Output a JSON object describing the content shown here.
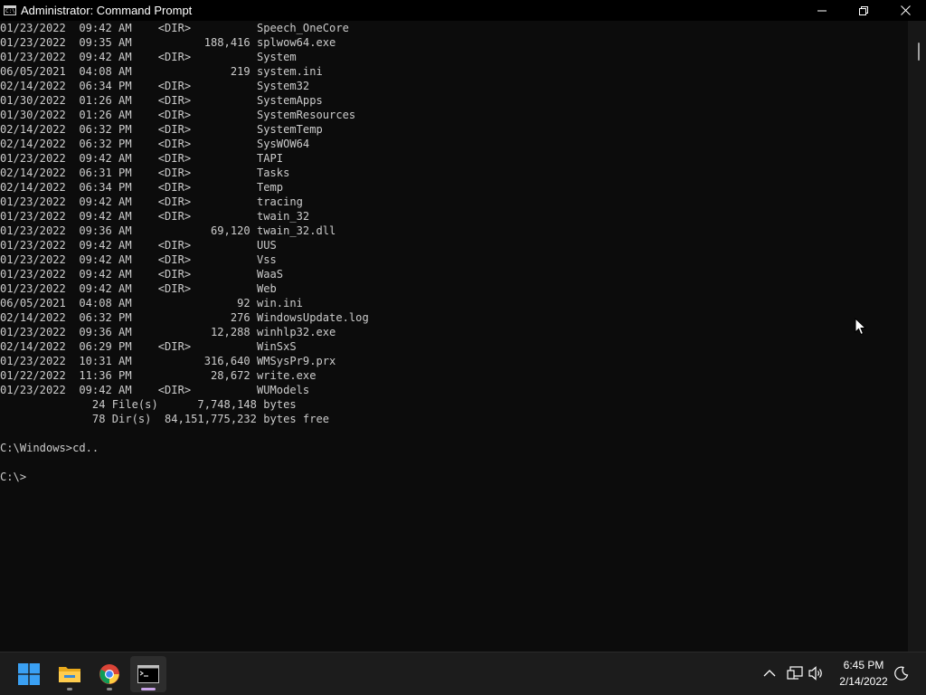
{
  "window": {
    "title": "Administrator: Command Prompt",
    "icon_text": "C:\\",
    "controls": [
      "minimize-icon",
      "restore-icon",
      "close-icon"
    ]
  },
  "console": {
    "lines": [
      "01/23/2022  09:42 AM    <DIR>          Speech_OneCore",
      "01/23/2022  09:35 AM           188,416 splwow64.exe",
      "01/23/2022  09:42 AM    <DIR>          System",
      "06/05/2021  04:08 AM               219 system.ini",
      "02/14/2022  06:34 PM    <DIR>          System32",
      "01/30/2022  01:26 AM    <DIR>          SystemApps",
      "01/30/2022  01:26 AM    <DIR>          SystemResources",
      "02/14/2022  06:32 PM    <DIR>          SystemTemp",
      "02/14/2022  06:32 PM    <DIR>          SysWOW64",
      "01/23/2022  09:42 AM    <DIR>          TAPI",
      "02/14/2022  06:31 PM    <DIR>          Tasks",
      "02/14/2022  06:34 PM    <DIR>          Temp",
      "01/23/2022  09:42 AM    <DIR>          tracing",
      "01/23/2022  09:42 AM    <DIR>          twain_32",
      "01/23/2022  09:36 AM            69,120 twain_32.dll",
      "01/23/2022  09:42 AM    <DIR>          UUS",
      "01/23/2022  09:42 AM    <DIR>          Vss",
      "01/23/2022  09:42 AM    <DIR>          WaaS",
      "01/23/2022  09:42 AM    <DIR>          Web",
      "06/05/2021  04:08 AM                92 win.ini",
      "02/14/2022  06:32 PM               276 WindowsUpdate.log",
      "01/23/2022  09:36 AM            12,288 winhlp32.exe",
      "02/14/2022  06:29 PM    <DIR>          WinSxS",
      "01/23/2022  10:31 AM           316,640 WMSysPr9.prx",
      "01/22/2022  11:36 PM            28,672 write.exe",
      "01/23/2022  09:42 AM    <DIR>          WUModels",
      "              24 File(s)      7,748,148 bytes",
      "              78 Dir(s)  84,151,775,232 bytes free",
      "",
      "C:\\Windows>cd..",
      "",
      "C:\\>"
    ]
  },
  "taskbar": {
    "apps": [
      {
        "name": "start-button",
        "icon": "windows-logo-icon"
      },
      {
        "name": "file-explorer-button",
        "icon": "folder-icon"
      },
      {
        "name": "chrome-button",
        "icon": "chrome-icon"
      },
      {
        "name": "command-prompt-button",
        "icon": "terminal-icon"
      }
    ],
    "tray": {
      "chevron": "chevron-up-icon",
      "network": "network-icon",
      "volume": "speaker-icon",
      "focus": "moon-icon"
    },
    "clock": {
      "time": "6:45 PM",
      "date": "2/14/2022"
    }
  },
  "colors": {
    "console_bg": "#0c0c0c",
    "console_text": "#cccccc",
    "taskbar_bg": "#1c1c1c",
    "active_indicator": "#c9a4e8"
  }
}
